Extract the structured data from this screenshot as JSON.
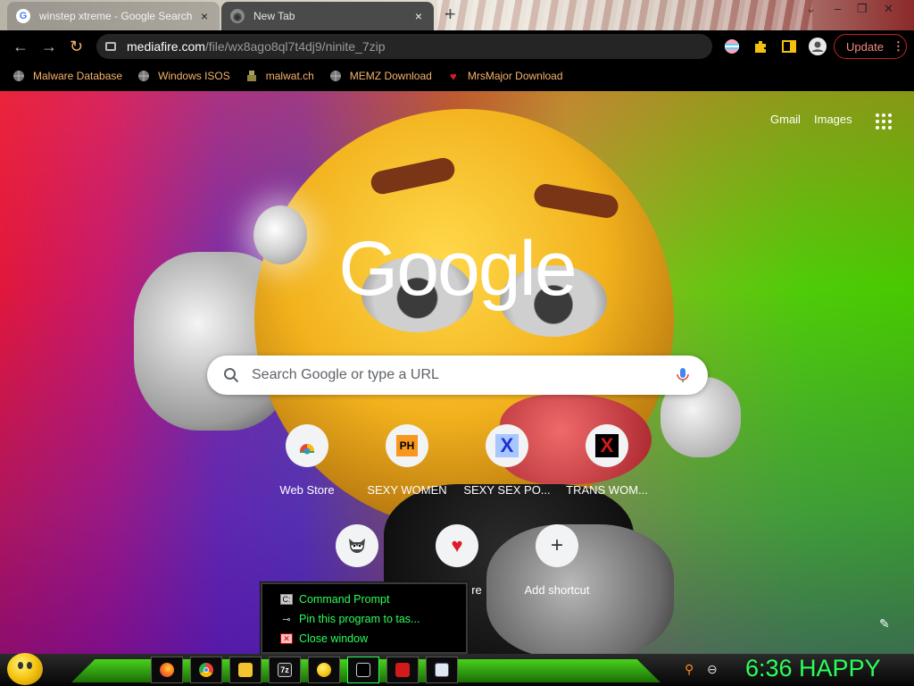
{
  "tabs": [
    {
      "title": "winstep xtreme - Google Search",
      "favicon": "google-favicon",
      "close": "×"
    },
    {
      "title": "New Tab",
      "favicon": "chrome-favicon",
      "close": "×"
    }
  ],
  "new_tab_label": "+",
  "window_controls": {
    "minimize": "–",
    "restore": "❐",
    "close": "✕"
  },
  "toolbar": {
    "back": "←",
    "forward": "→",
    "reload": "↻",
    "url_domain": "mediafire.com",
    "url_path": "/file/wx8ago8ql7t4dj9/ninite_7zip",
    "update_label": "Update",
    "menu": "⋮"
  },
  "bookmarks": [
    {
      "label": "Malware Database",
      "icon": "globe-icon"
    },
    {
      "label": "Windows ISOS",
      "icon": "globe-icon"
    },
    {
      "label": "malwat.ch",
      "icon": "idol-icon"
    },
    {
      "label": "MEMZ Download",
      "icon": "globe-icon"
    },
    {
      "label": "MrsMajor Download",
      "icon": "heart-icon"
    }
  ],
  "ntp": {
    "gmail": "Gmail",
    "images": "Images",
    "logo": "Google",
    "search_placeholder": "Search Google or type a URL",
    "shortcuts": [
      {
        "label": "Web Store",
        "icon": "webstore-icon"
      },
      {
        "label": "SEXY WOMEN",
        "icon": "ph-icon",
        "icon_text": "PH"
      },
      {
        "label": "SEXY SEX PO...",
        "icon": "x-blue-icon",
        "icon_text": "X"
      },
      {
        "label": "TRANS WOM...",
        "icon": "x-red-icon",
        "icon_text": "X"
      },
      {
        "label": "",
        "icon": "raccoon-icon"
      },
      {
        "label": "re",
        "icon": "heart-icon"
      },
      {
        "label": "Add shortcut",
        "icon": "plus-icon",
        "icon_text": "+"
      }
    ]
  },
  "context_menu": [
    {
      "label": "Command Prompt",
      "icon": "cmd-icon"
    },
    {
      "label": "Pin this program to tas...",
      "icon": "pin-icon"
    },
    {
      "label": "Close window",
      "icon": "close-window-icon"
    }
  ],
  "taskbar": {
    "apps": [
      "firefox-icon",
      "chrome-icon",
      "folder-icon",
      "7zip-icon",
      "emoji-icon",
      "cmd-icon",
      "paint-icon",
      "window-icon"
    ],
    "sevenzip_text": "7z",
    "clock": "6:36 HAPPY"
  },
  "colors": {
    "accent_green": "#2bff5a",
    "bookmark_text": "#f6b26b",
    "update_red": "#c5221f"
  }
}
